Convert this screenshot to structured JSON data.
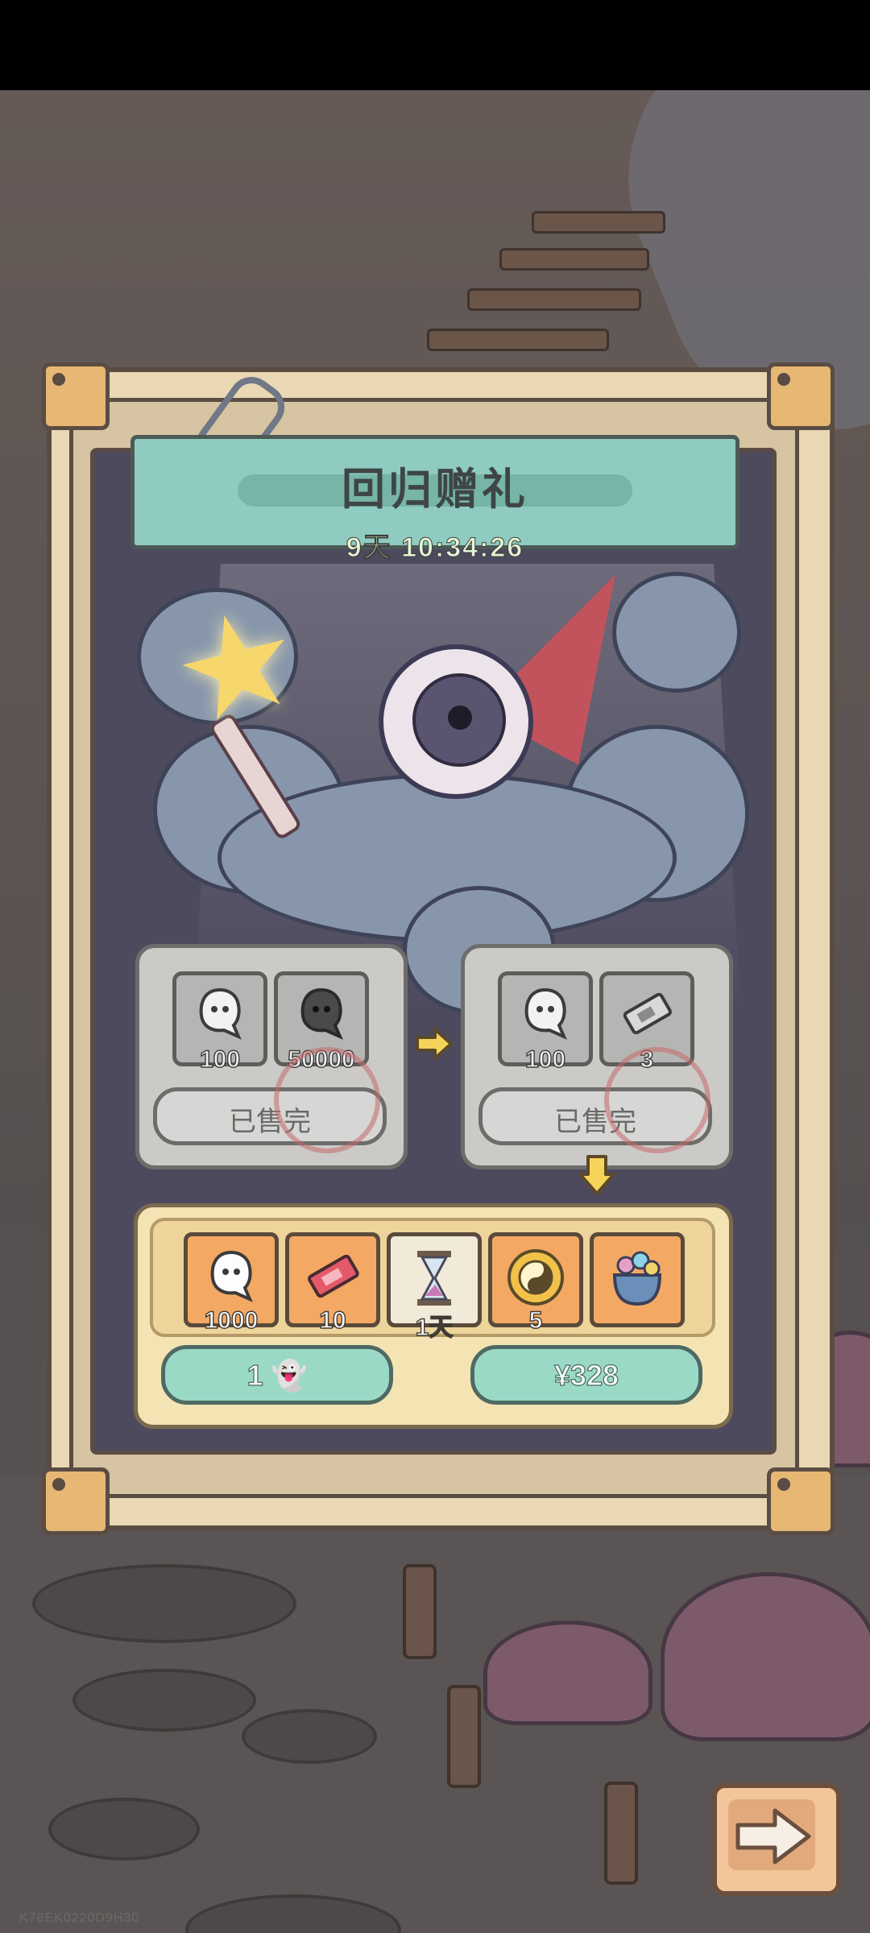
{
  "panel": {
    "title": "回归赠礼",
    "countdown": "9天 10:34:26"
  },
  "offers": [
    {
      "items": [
        {
          "icon": "ghost-icon",
          "count": "100"
        },
        {
          "icon": "dark-ghost-icon",
          "count": "50000"
        }
      ],
      "button_label": "已售完"
    },
    {
      "items": [
        {
          "icon": "ghost-icon",
          "count": "100"
        },
        {
          "icon": "ticket-icon",
          "count": "3"
        }
      ],
      "button_label": "已售完"
    }
  ],
  "reward": {
    "items": [
      {
        "icon": "ghost-icon",
        "count": "1000"
      },
      {
        "icon": "red-ticket-icon",
        "count": "10"
      },
      {
        "icon": "hourglass-icon",
        "count": "1天"
      },
      {
        "icon": "yin-yang-coin-icon",
        "count": "5"
      },
      {
        "icon": "gift-bag-icon",
        "count": ""
      }
    ],
    "ghost_price": "1",
    "cash_price": "¥328"
  },
  "watermark": "K78EK0220D9H30",
  "colors": {
    "ribbon": "#8fcbc0",
    "frame": "#e9d8b3",
    "reward_slot": "#f3a964",
    "sold_out_box": "#cbcac7",
    "price_button": "#9bd9c7"
  }
}
